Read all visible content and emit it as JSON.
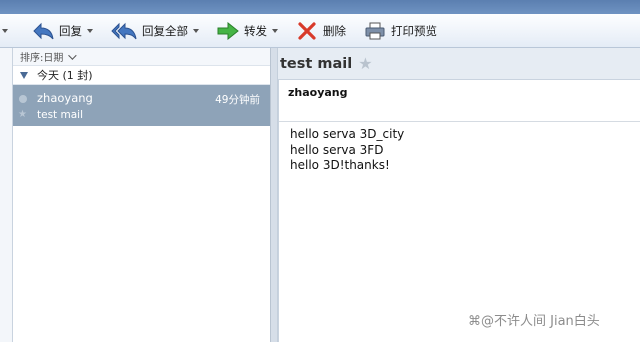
{
  "toolbar": {
    "reply": "回复",
    "reply_all": "回复全部",
    "forward": "转发",
    "delete": "删除",
    "print_preview": "打印预览",
    "icons": {
      "reply": "reply-arrow-icon",
      "reply_all": "reply-all-arrow-icon",
      "forward": "forward-arrow-icon",
      "delete": "delete-x-icon",
      "print_preview": "printer-icon"
    },
    "colors": {
      "reply": "#3f6fb8",
      "forward": "#3aa23a",
      "delete": "#d83a2a"
    }
  },
  "list": {
    "sort_label": "排序:日期",
    "group_label": "今天 (1 封)",
    "messages": [
      {
        "from": "zhaoyang",
        "time": "49分钟前",
        "subject": "test mail",
        "selected_color": "#8ea3b8"
      }
    ]
  },
  "reader": {
    "subject": "test mail",
    "sender": "zhaoyang",
    "body_lines": [
      "hello serva 3D_city",
      "hello serva 3FD",
      "hello 3D!thanks!"
    ]
  },
  "watermark": "⌘@不许人间 Jian白头"
}
